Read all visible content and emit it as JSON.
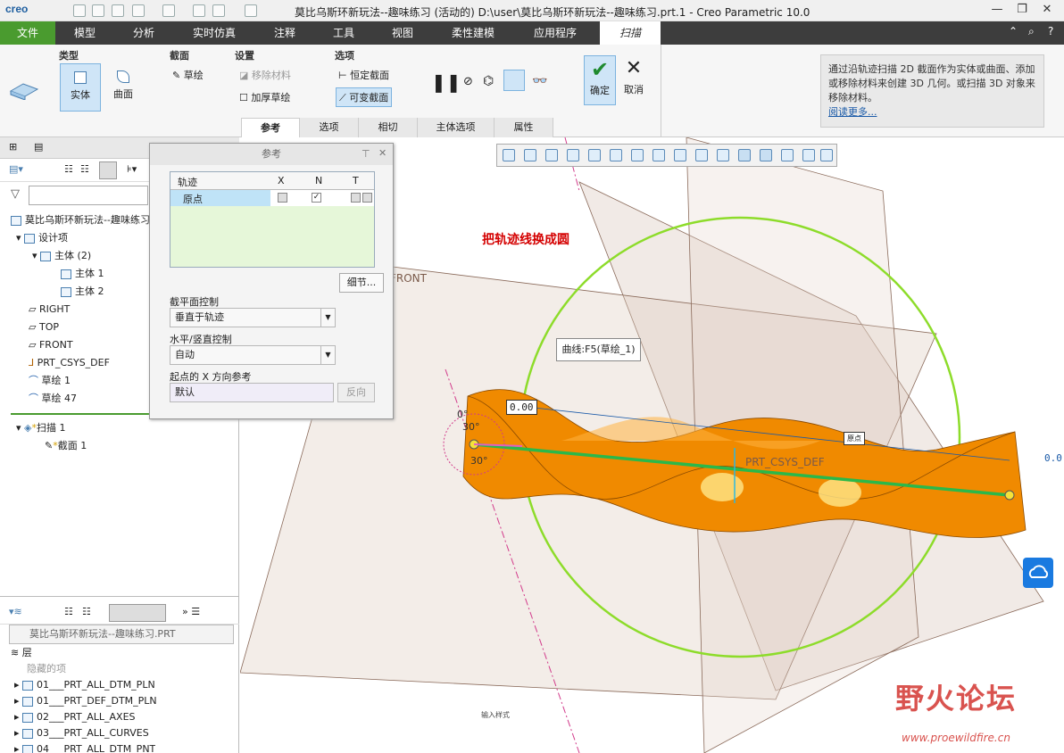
{
  "app": {
    "logo": "creo",
    "window_title": "莫比乌斯环新玩法--趣味练习 (活动的) D:\\user\\莫比乌斯环新玩法--趣味练习.prt.1 - Creo Parametric 10.0"
  },
  "menu": {
    "items": [
      "文件",
      "模型",
      "分析",
      "实时仿真",
      "注释",
      "工具",
      "视图",
      "柔性建模",
      "应用程序",
      "扫描"
    ]
  },
  "ribbon": {
    "groups": {
      "type": "类型",
      "section": "截面",
      "settings": "设置",
      "options": "选项"
    },
    "type_solid": "实体",
    "type_surface": "曲面",
    "sketch": "草绘",
    "remove_material": "移除材料",
    "thicken_sketch": "加厚草绘",
    "constant_section": "恒定截面",
    "variable_section": "可变截面",
    "ok": "确定",
    "cancel": "取消",
    "subtabs": [
      "参考",
      "选项",
      "相切",
      "主体选项",
      "属性"
    ]
  },
  "help": {
    "text": "通过沿轨迹扫描 2D 截面作为实体或曲面、添加或移除材料来创建 3D 几何。或扫描 3D 对象来移除材料。",
    "more": "阅读更多..."
  },
  "ref_panel": {
    "title": "参考",
    "col_traj": "轨迹",
    "col_x": "X",
    "col_n": "N",
    "col_t": "T",
    "row_traj": "原点",
    "details": "细节...",
    "section_plane_label": "截平面控制",
    "section_plane_value": "垂直于轨迹",
    "hv_label": "水平/竖直控制",
    "hv_value": "自动",
    "start_x_label": "起点的 X 方向参考",
    "start_x_value": "默认",
    "flip": "反向"
  },
  "model_tree": {
    "root": "莫比乌斯环新玩法--趣味练习",
    "items": [
      "设计项",
      "主体 (2)",
      "主体 1",
      "主体 2",
      "RIGHT",
      "TOP",
      "FRONT",
      "PRT_CSYS_DEF",
      "草绘 1",
      "草绘 47",
      "扫描 1",
      "截面 1"
    ]
  },
  "layer_tree": {
    "model": "莫比乌斯环新玩法--趣味练习.PRT",
    "header": "层",
    "items": [
      "隐藏的项",
      "01___PRT_ALL_DTM_PLN",
      "01___PRT_DEF_DTM_PLN",
      "02___PRT_ALL_AXES",
      "03___PRT_ALL_CURVES",
      "04___PRT_ALL_DTM_PNT"
    ]
  },
  "viewport": {
    "annotation": "把轨迹线换成圆",
    "curve_tip": "曲线:F5(草绘_1)",
    "dim1": "0.00",
    "dim2": "0.0",
    "angle1": "0°",
    "angle2": "30°",
    "angle3": "30°",
    "front_label": "FRONT",
    "csys_label": "PRT_CSYS_DEF",
    "origin_label": "原点",
    "mode_label": "输入样式"
  },
  "watermark": {
    "text": "野火论坛",
    "url": "www.proewildfire.cn"
  },
  "colors": {
    "accent_green": "#4a9b2f",
    "twist_orange": "#f08a00",
    "circle_green": "#8ddc2a",
    "traj_green": "#2bb84a"
  }
}
